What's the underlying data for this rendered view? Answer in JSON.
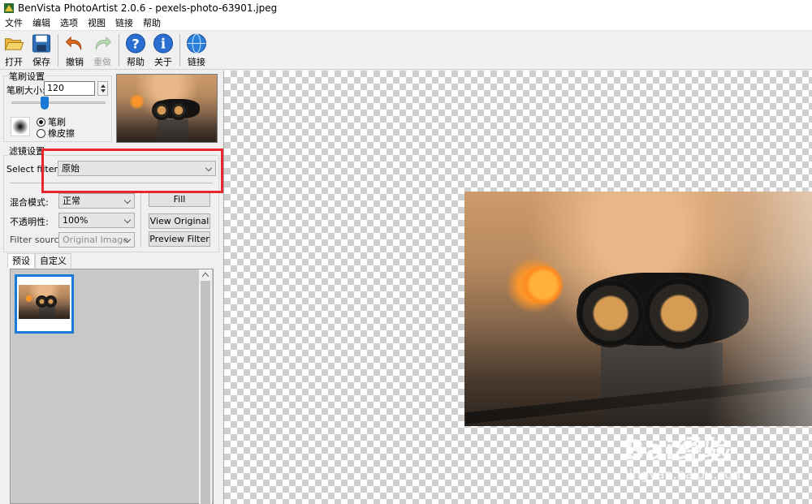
{
  "window": {
    "title": "BenVista PhotoArtist 2.0.6 - pexels-photo-63901.jpeg"
  },
  "menu": [
    "文件",
    "编辑",
    "选项",
    "视图",
    "链接",
    "帮助"
  ],
  "toolbar": {
    "open": "打开",
    "save": "保存",
    "undo": "撤销",
    "redo": "重做",
    "help": "帮助",
    "about": "关于",
    "link": "链接"
  },
  "brush": {
    "group_label": "笔刷设置",
    "size_label": "笔刷大小:",
    "size_value": "120",
    "slider_level": 0.35,
    "mode_brush": "笔刷",
    "mode_eraser": "橡皮擦",
    "selected_mode": "brush"
  },
  "filter": {
    "group_label": "滤镜设置",
    "select_label": "Select filter:",
    "selected": "原始",
    "blend_label": "混合模式:",
    "blend_value": "正常",
    "opacity_label": "不透明性:",
    "opacity_value": "100%",
    "source_label": "Filter source:",
    "source_value": "Original Image",
    "fill_button": "Fill",
    "view_original_button": "View Original",
    "preview_filter_button": "Preview Filter"
  },
  "presets": {
    "tabs": [
      "预设",
      "自定义"
    ],
    "active_tab": 0
  },
  "watermark": {
    "main": "Bai经验",
    "sub": "jingyan.baidu.com"
  },
  "colors": {
    "highlight": "#e8262d",
    "accent": "#1a7bd6"
  }
}
